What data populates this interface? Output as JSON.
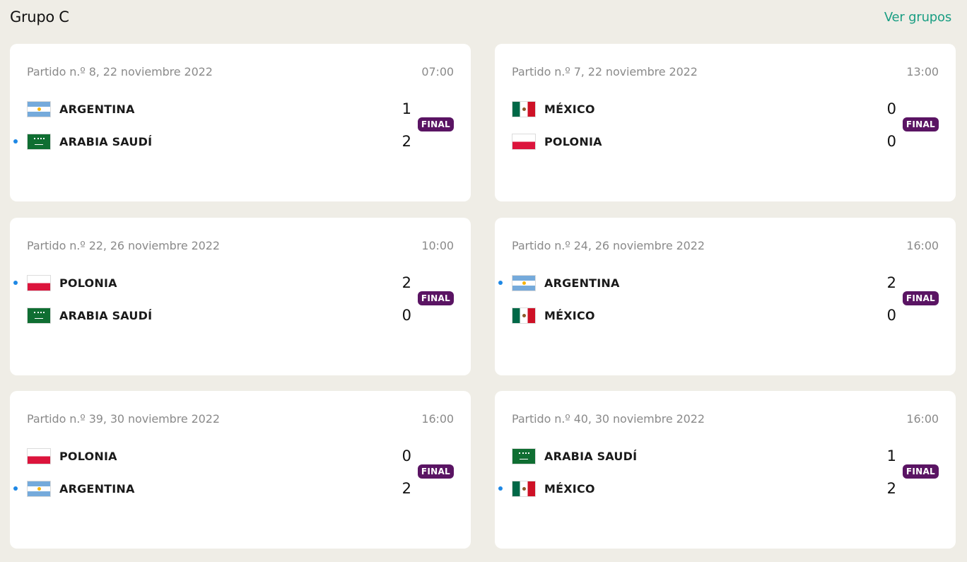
{
  "header": {
    "title": "Grupo C",
    "link": "Ver grupos"
  },
  "matches": [
    {
      "meta": "Partido n.º 8, 22 noviembre 2022",
      "time": "07:00",
      "status": "FINAL",
      "home": {
        "name": "ARGENTINA",
        "score": "1",
        "flag": "arg",
        "winner": false
      },
      "away": {
        "name": "ARABIA SAUDÍ",
        "score": "2",
        "flag": "ksa",
        "winner": true
      }
    },
    {
      "meta": "Partido n.º 7, 22 noviembre 2022",
      "time": "13:00",
      "status": "FINAL",
      "home": {
        "name": "MÉXICO",
        "score": "0",
        "flag": "mex",
        "winner": false
      },
      "away": {
        "name": "POLONIA",
        "score": "0",
        "flag": "pol",
        "winner": false
      }
    },
    {
      "meta": "Partido n.º 22, 26 noviembre 2022",
      "time": "10:00",
      "status": "FINAL",
      "home": {
        "name": "POLONIA",
        "score": "2",
        "flag": "pol",
        "winner": true
      },
      "away": {
        "name": "ARABIA SAUDÍ",
        "score": "0",
        "flag": "ksa",
        "winner": false
      }
    },
    {
      "meta": "Partido n.º 24, 26 noviembre 2022",
      "time": "16:00",
      "status": "FINAL",
      "home": {
        "name": "ARGENTINA",
        "score": "2",
        "flag": "arg",
        "winner": true
      },
      "away": {
        "name": "MÉXICO",
        "score": "0",
        "flag": "mex",
        "winner": false
      }
    },
    {
      "meta": "Partido n.º 39, 30 noviembre 2022",
      "time": "16:00",
      "status": "FINAL",
      "home": {
        "name": "POLONIA",
        "score": "0",
        "flag": "pol",
        "winner": false
      },
      "away": {
        "name": "ARGENTINA",
        "score": "2",
        "flag": "arg",
        "winner": true
      }
    },
    {
      "meta": "Partido n.º 40, 30 noviembre 2022",
      "time": "16:00",
      "status": "FINAL",
      "home": {
        "name": "ARABIA SAUDÍ",
        "score": "1",
        "flag": "ksa",
        "winner": false
      },
      "away": {
        "name": "MÉXICO",
        "score": "2",
        "flag": "mex",
        "winner": true
      }
    }
  ]
}
